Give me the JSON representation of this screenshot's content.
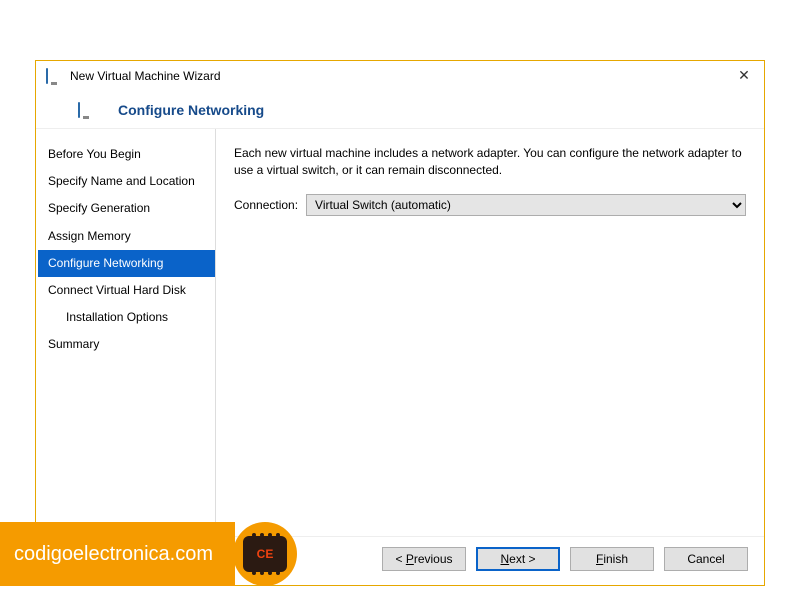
{
  "window": {
    "title": "New Virtual Machine Wizard",
    "close_tooltip": "Close"
  },
  "header": {
    "title": "Configure Networking"
  },
  "sidebar": {
    "items": [
      {
        "label": "Before You Begin",
        "active": false,
        "indent": false
      },
      {
        "label": "Specify Name and Location",
        "active": false,
        "indent": false
      },
      {
        "label": "Specify Generation",
        "active": false,
        "indent": false
      },
      {
        "label": "Assign Memory",
        "active": false,
        "indent": false
      },
      {
        "label": "Configure Networking",
        "active": true,
        "indent": false
      },
      {
        "label": "Connect Virtual Hard Disk",
        "active": false,
        "indent": false
      },
      {
        "label": "Installation Options",
        "active": false,
        "indent": true
      },
      {
        "label": "Summary",
        "active": false,
        "indent": false
      }
    ]
  },
  "content": {
    "description": "Each new virtual machine includes a network adapter. You can configure the network adapter to use a virtual switch, or it can remain disconnected.",
    "connection_label": "Connection:",
    "connection_value": "Virtual Switch (automatic)"
  },
  "footer": {
    "previous_full": "< Previous",
    "previous_key": "P",
    "next_full": "Next >",
    "next_key": "N",
    "finish_full": "Finish",
    "finish_key": "F",
    "cancel": "Cancel"
  },
  "watermark": {
    "text": "codigoelectronica.com",
    "chip_text": "CE"
  }
}
